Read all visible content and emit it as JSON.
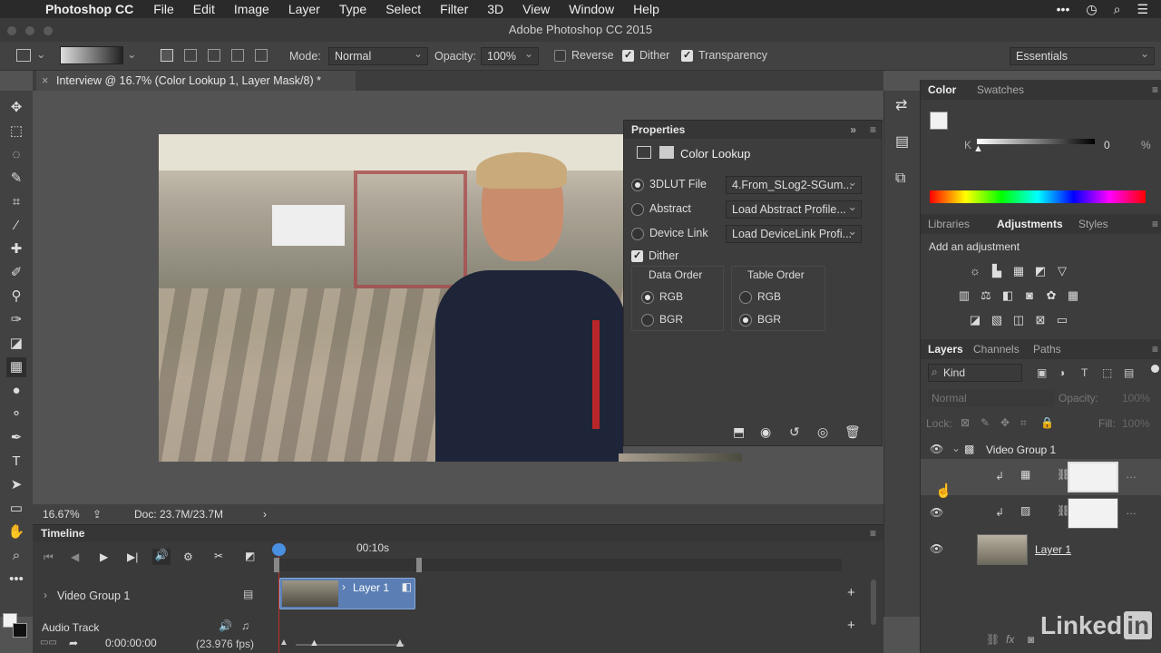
{
  "menubar": {
    "app": "Photoshop CC",
    "items": [
      "File",
      "Edit",
      "Image",
      "Layer",
      "Type",
      "Select",
      "Filter",
      "3D",
      "View",
      "Window",
      "Help"
    ]
  },
  "window": {
    "title": "Adobe Photoshop CC 2015"
  },
  "options": {
    "mode_label": "Mode:",
    "mode_value": "Normal",
    "opacity_label": "Opacity:",
    "opacity_value": "100%",
    "reverse": "Reverse",
    "dither": "Dither",
    "transparency": "Transparency",
    "workspace": "Essentials"
  },
  "document": {
    "tab_title": "Interview @ 16.7% (Color Lookup 1, Layer Mask/8) *",
    "zoom": "16.67%",
    "doc_size": "Doc: 23.7M/23.7M"
  },
  "properties": {
    "title": "Properties",
    "adjustment": "Color Lookup",
    "lut_label": "3DLUT File",
    "lut_value": "4.From_SLog2-SGum...",
    "abstract_label": "Abstract",
    "abstract_value": "Load Abstract Profile...",
    "devicelink_label": "Device Link",
    "devicelink_value": "Load DeviceLink Profi...",
    "dither": "Dither",
    "data_order": "Data Order",
    "table_order": "Table Order",
    "rgb": "RGB",
    "bgr": "BGR"
  },
  "color_panel": {
    "tabs": [
      "Color",
      "Swatches"
    ],
    "k_label": "K",
    "k_value": "0",
    "pct": "%"
  },
  "adjust_panel": {
    "tabs": [
      "Libraries",
      "Adjustments",
      "Styles"
    ],
    "heading": "Add an adjustment"
  },
  "layers_panel": {
    "tabs": [
      "Layers",
      "Channels",
      "Paths"
    ],
    "filter": "Kind",
    "blend": "Normal",
    "opacity": "Opacity:",
    "opacity_value": "100%",
    "lock": "Lock:",
    "fill": "Fill:",
    "fill_value": "100%",
    "group_name": "Video Group 1",
    "layer_name": "Layer 1"
  },
  "timeline": {
    "title": "Timeline",
    "time_marker": "00:10s",
    "video_group": "Video Group 1",
    "clip_label": "Layer 1",
    "audio_track": "Audio Track",
    "timecode": "0:00:00:00",
    "fps": "(23.976 fps)"
  },
  "watermark": {
    "brand": "Linked",
    "in": "in"
  }
}
